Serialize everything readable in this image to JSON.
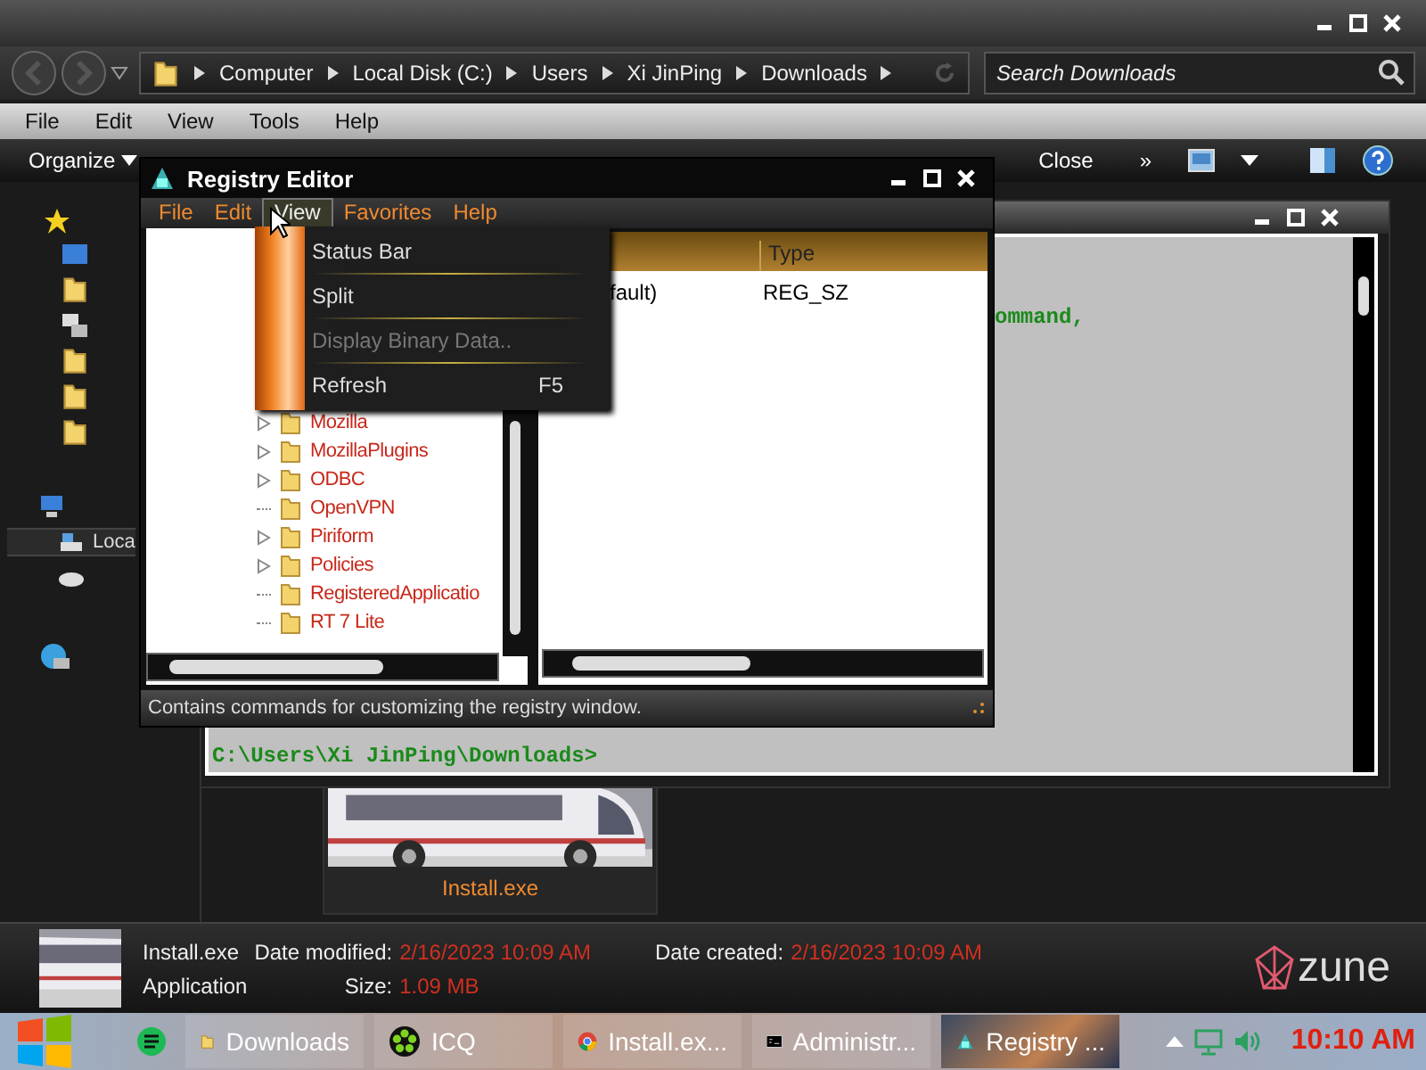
{
  "explorer": {
    "address": [
      "Computer",
      "Local Disk (C:)",
      "Users",
      "Xi JinPing",
      "Downloads"
    ],
    "search": {
      "placeholder": "Search Downloads"
    },
    "menu": [
      "File",
      "Edit",
      "View",
      "Tools",
      "Help"
    ],
    "toolbar": {
      "organize": "Organize",
      "close": "Close",
      "more": "»"
    },
    "nav": [
      {
        "label": "Loca",
        "selected": true
      }
    ],
    "file": {
      "name": "Install.exe"
    },
    "details": {
      "name": "Install.exe",
      "type": "Application",
      "modified_label": "Date modified:",
      "modified": "2/16/2023 10:09 AM",
      "created_label": "Date created:",
      "created": "2/16/2023 10:09 AM",
      "size_label": "Size:",
      "size": "1.09 MB"
    },
    "logo": "zune"
  },
  "cmd": {
    "lines": [
      "ommand,",
      "C:\\Users\\Xi JinPing\\Downloads>"
    ]
  },
  "regedit": {
    "title": "Registry Editor",
    "menu": [
      {
        "label": "File",
        "selected": false
      },
      {
        "label": "Edit",
        "selected": false
      },
      {
        "label": "View",
        "selected": true
      },
      {
        "label": "Favorites",
        "selected": false
      },
      {
        "label": "Help",
        "selected": false
      }
    ],
    "tree": [
      {
        "label": "Mozilla",
        "expandable": true
      },
      {
        "label": "MozillaPlugins",
        "expandable": true
      },
      {
        "label": "ODBC",
        "expandable": true
      },
      {
        "label": "OpenVPN",
        "expandable": false
      },
      {
        "label": "Piriform",
        "expandable": true
      },
      {
        "label": "Policies",
        "expandable": true
      },
      {
        "label": "RegisteredApplicatio",
        "expandable": false
      },
      {
        "label": "RT 7 Lite",
        "expandable": false
      }
    ],
    "columns": [
      "Type"
    ],
    "rows": [
      {
        "name": "fault)",
        "type": "REG_SZ"
      }
    ],
    "status": "Contains commands for customizing the registry window."
  },
  "view_menu": [
    {
      "label": "Status Bar",
      "disabled": false
    },
    {
      "label": "Split",
      "disabled": false
    },
    {
      "label": "Display Binary Data..",
      "disabled": true
    },
    {
      "label": "Refresh",
      "disabled": false,
      "shortcut": "F5"
    }
  ],
  "taskbar": {
    "items": [
      {
        "label": "Downloads",
        "kind": "folder",
        "selected": false
      },
      {
        "label": "ICQ",
        "kind": "icq",
        "selected": false
      },
      {
        "label": "Install.ex...",
        "kind": "browser",
        "selected": false
      },
      {
        "label": "Administr...",
        "kind": "console",
        "selected": false
      },
      {
        "label": "Registry ...",
        "kind": "registry",
        "selected": true
      }
    ],
    "clock": "10:10 AM"
  }
}
